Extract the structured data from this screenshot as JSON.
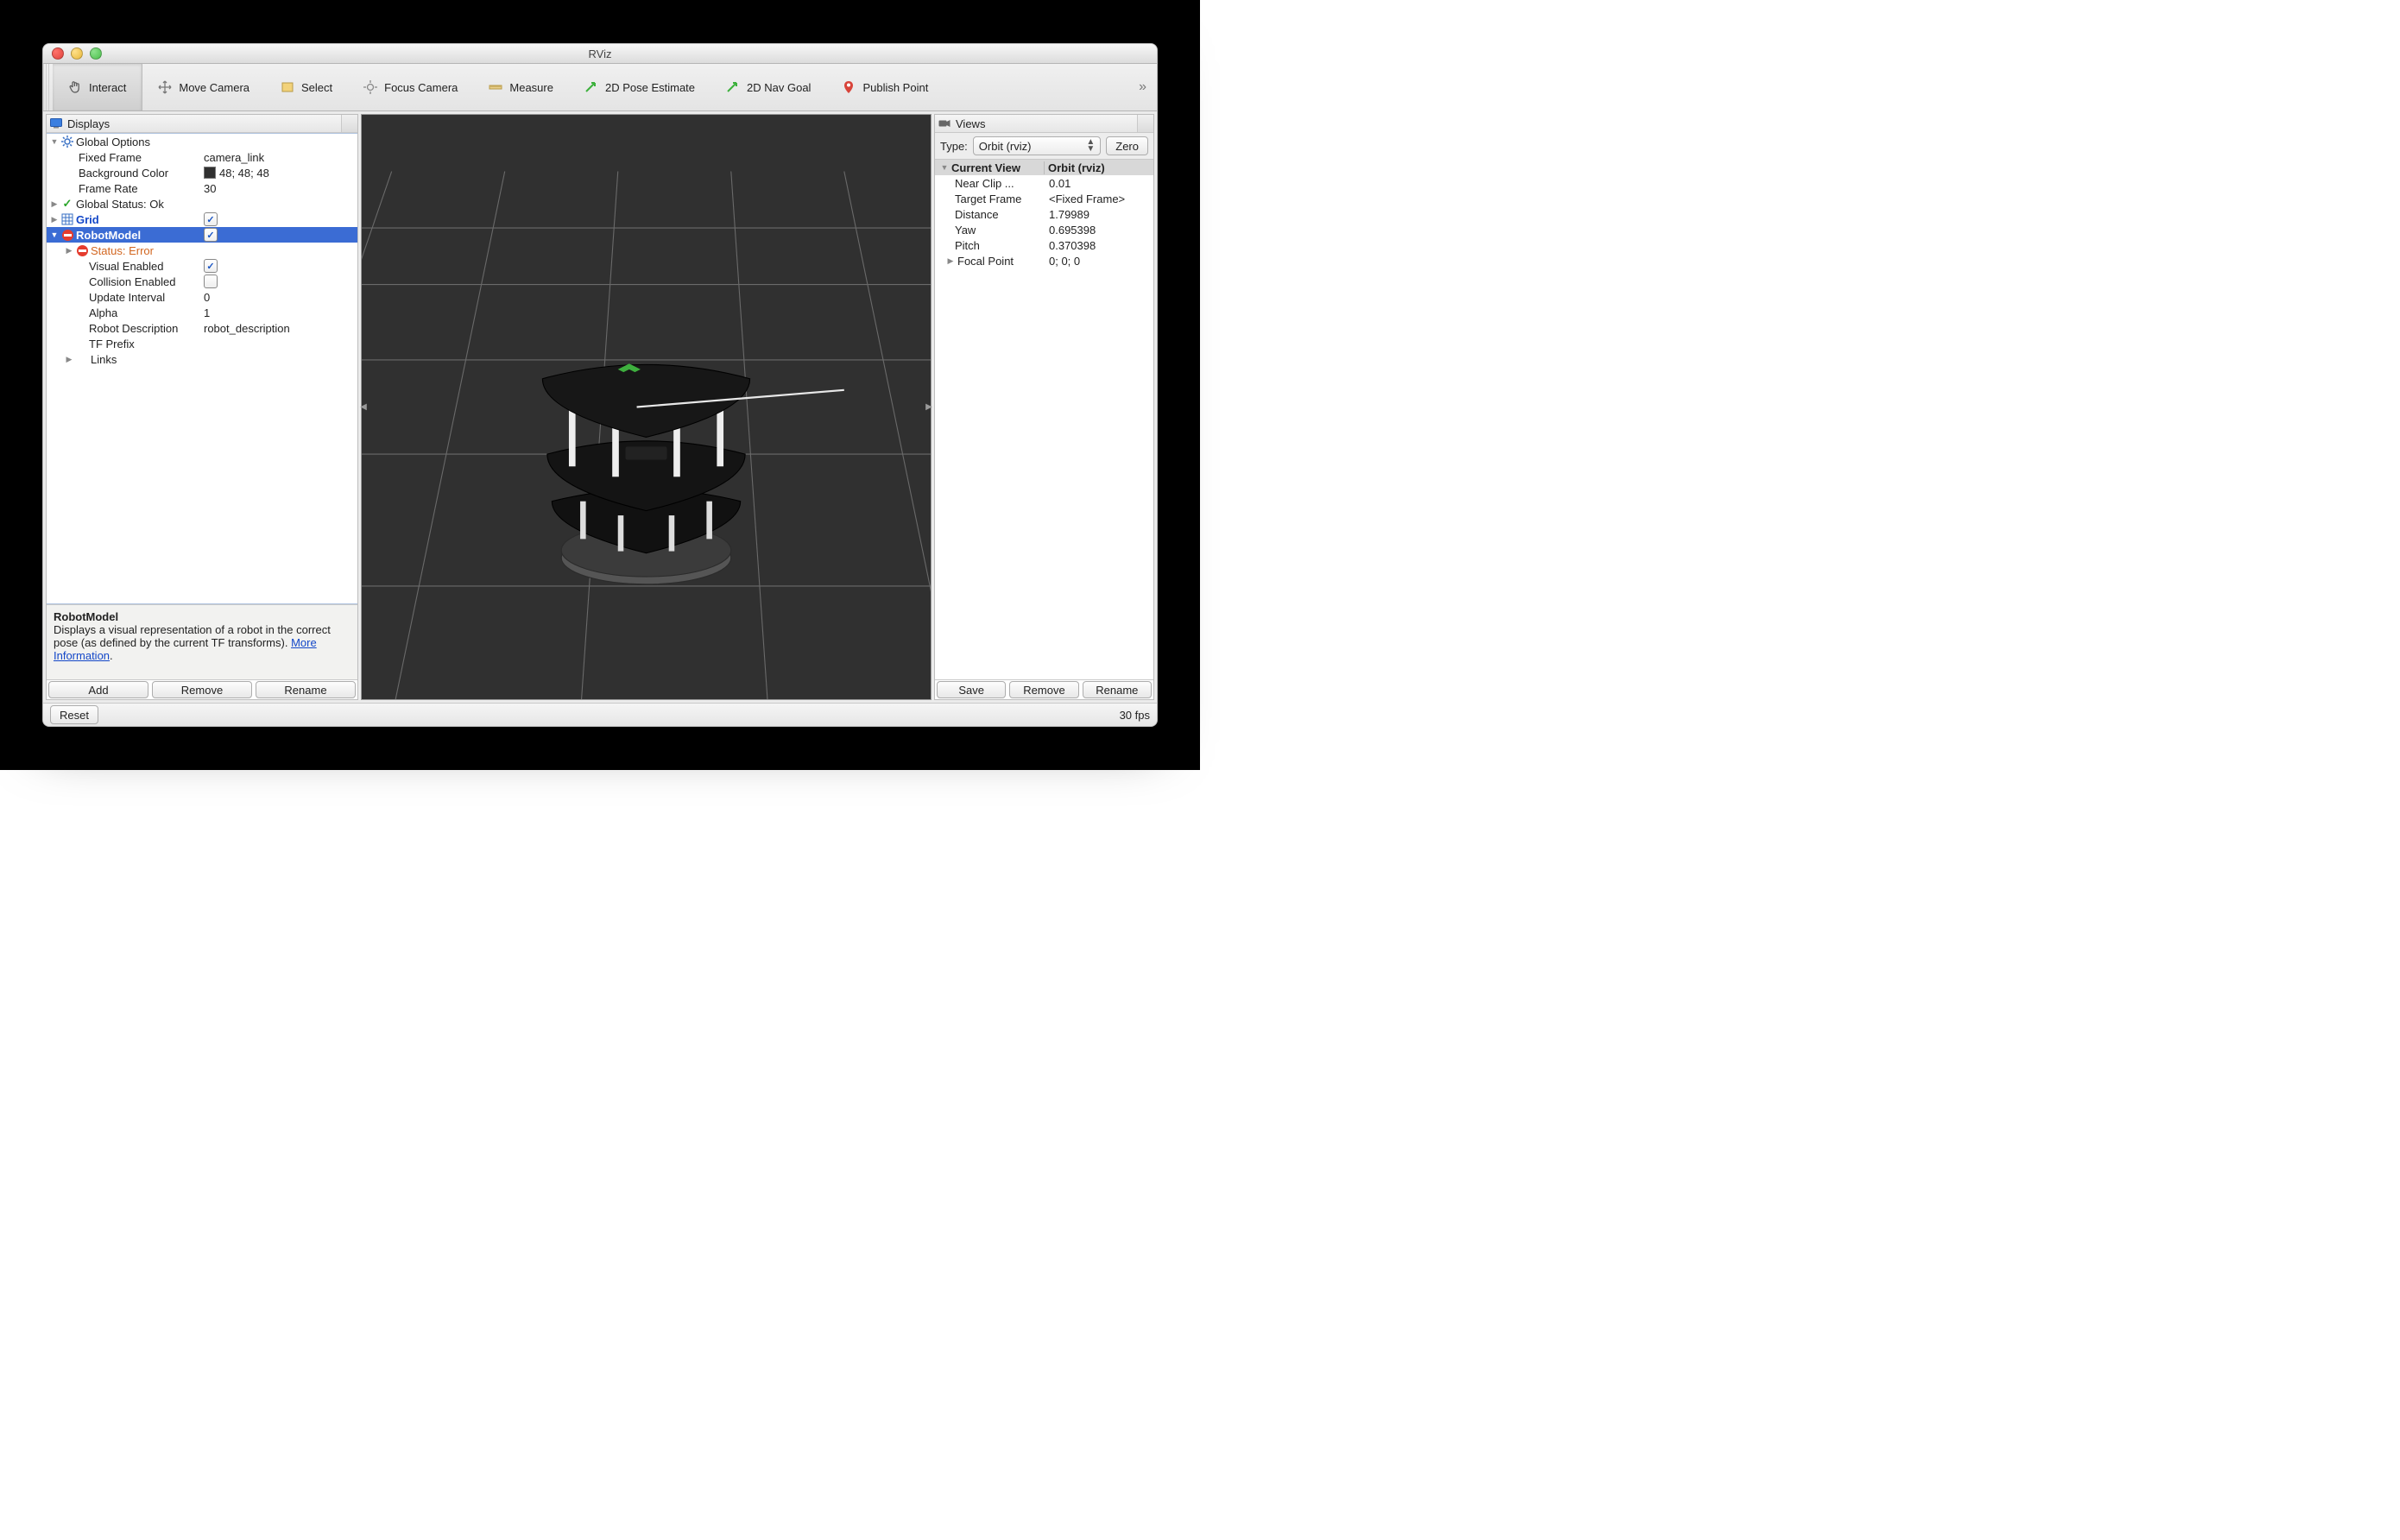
{
  "window": {
    "title": "RViz"
  },
  "toolbar": {
    "items": [
      {
        "label": "Interact",
        "icon": "hand-pointer-icon",
        "active": true
      },
      {
        "label": "Move Camera",
        "icon": "move-arrows-icon",
        "active": false
      },
      {
        "label": "Select",
        "icon": "select-rect-icon",
        "active": false
      },
      {
        "label": "Focus Camera",
        "icon": "crosshair-icon",
        "active": false
      },
      {
        "label": "Measure",
        "icon": "ruler-icon",
        "active": false
      },
      {
        "label": "2D Pose Estimate",
        "icon": "green-arrow-icon",
        "active": false
      },
      {
        "label": "2D Nav Goal",
        "icon": "green-arrow-icon",
        "active": false
      },
      {
        "label": "Publish Point",
        "icon": "pin-icon",
        "active": false
      }
    ],
    "overflow_glyph": "»"
  },
  "displays_panel": {
    "title": "Displays",
    "global_options": {
      "label": "Global Options",
      "fixed_frame": {
        "label": "Fixed Frame",
        "value": "camera_link"
      },
      "background_color": {
        "label": "Background Color",
        "value": "48; 48; 48",
        "swatch": "#303030"
      },
      "frame_rate": {
        "label": "Frame Rate",
        "value": "30"
      }
    },
    "global_status": {
      "label": "Global Status: Ok"
    },
    "grid": {
      "label": "Grid",
      "checked": true
    },
    "robot_model": {
      "label": "RobotModel",
      "checked": true,
      "status": {
        "label": "Status: Error"
      },
      "visual_enabled": {
        "label": "Visual Enabled",
        "checked": true
      },
      "collision_enabled": {
        "label": "Collision Enabled",
        "checked": false
      },
      "update_interval": {
        "label": "Update Interval",
        "value": "0"
      },
      "alpha": {
        "label": "Alpha",
        "value": "1"
      },
      "robot_description": {
        "label": "Robot Description",
        "value": "robot_description"
      },
      "tf_prefix": {
        "label": "TF Prefix",
        "value": ""
      },
      "links": {
        "label": "Links"
      }
    },
    "description": {
      "title": "RobotModel",
      "body": "Displays a visual representation of a robot in the correct pose (as defined by the current TF transforms).",
      "link_text": "More Information"
    },
    "buttons": {
      "add": "Add",
      "remove": "Remove",
      "rename": "Rename"
    }
  },
  "views_panel": {
    "title": "Views",
    "type_label": "Type:",
    "type_value": "Orbit (rviz)",
    "zero_label": "Zero",
    "header": {
      "name": "Current View",
      "value": "Orbit (rviz)"
    },
    "rows": [
      {
        "name": "Near Clip ...",
        "value": "0.01",
        "expand": "none"
      },
      {
        "name": "Target Frame",
        "value": "<Fixed Frame>",
        "expand": "none"
      },
      {
        "name": "Distance",
        "value": "1.79989",
        "expand": "none"
      },
      {
        "name": "Yaw",
        "value": "0.695398",
        "expand": "none"
      },
      {
        "name": "Pitch",
        "value": "0.370398",
        "expand": "none"
      },
      {
        "name": "Focal Point",
        "value": "0; 0; 0",
        "expand": "closed"
      }
    ],
    "buttons": {
      "save": "Save",
      "remove": "Remove",
      "rename": "Rename"
    }
  },
  "statusbar": {
    "reset": "Reset",
    "fps": "30 fps"
  }
}
